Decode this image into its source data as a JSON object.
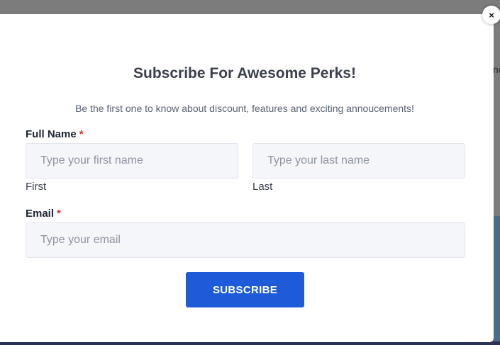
{
  "backdrop": {
    "partial_text": "nc"
  },
  "modal": {
    "close_icon": "×",
    "title": "Subscribe For Awesome Perks!",
    "subtitle": "Be the first one to know about discount, features and exciting annoucements!",
    "full_name": {
      "label": "Full Name",
      "required_mark": "*",
      "first": {
        "placeholder": "Type your first name",
        "value": "",
        "sub_label": "First"
      },
      "last": {
        "placeholder": "Type your last name",
        "value": "",
        "sub_label": "Last"
      }
    },
    "email": {
      "label": "Email",
      "required_mark": "*",
      "placeholder": "Type your email",
      "value": ""
    },
    "subscribe_label": "SUBSCRIBE"
  },
  "colors": {
    "accent": "#1e5bd8",
    "required": "#d92f2f",
    "input_bg": "#f5f6fa"
  }
}
